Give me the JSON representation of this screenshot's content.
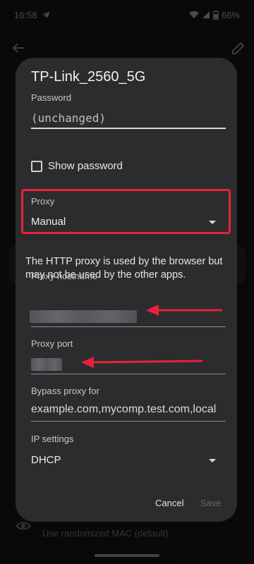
{
  "status_bar": {
    "time": "16:58",
    "battery": "66%"
  },
  "dialog": {
    "title": "TP-Link_2560_5G",
    "password": {
      "label": "Password",
      "value": "(unchanged)"
    },
    "show_password": {
      "label": "Show password"
    },
    "proxy": {
      "label": "Proxy",
      "value": "Manual"
    },
    "info": "The HTTP proxy is used by the browser but may not be used by the other apps.",
    "proxy_hostname": {
      "label": "Proxy hostname"
    },
    "proxy_port": {
      "label": "Proxy port"
    },
    "bypass": {
      "label": "Bypass proxy for",
      "value": "example.com,mycomp.test.com,local"
    },
    "ip_settings": {
      "label": "IP settings",
      "value": "DHCP"
    },
    "actions": {
      "cancel": "Cancel",
      "save": "Save"
    }
  },
  "background": {
    "privacy_sub": "Use randomized MAC (default)"
  },
  "colors": {
    "highlight": "#e8213a",
    "dialog_bg": "#2c2c2e"
  }
}
